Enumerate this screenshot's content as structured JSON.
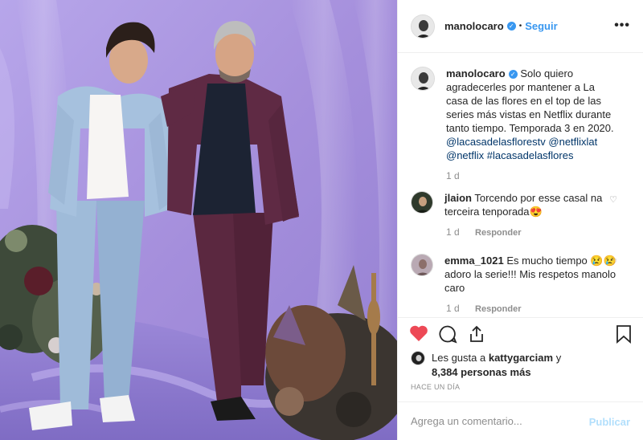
{
  "post": {
    "author": "manolocaro",
    "verified_mark": "✓",
    "dot": "•",
    "follow_label": "Seguir",
    "more_label": "•••"
  },
  "caption": {
    "user": "manolocaro",
    "text": "Solo quiero agradecerles por mantener a La casa de las flores en el top de las series más vistas en Netflix durante tanto tiempo. Temporada 3 en 2020.",
    "tags": [
      "@lacasadelasflorestv",
      "@netflixlat",
      "@netflix",
      "#lacasadelasflores"
    ],
    "age": "1 d"
  },
  "comments": [
    {
      "user": "jlaion",
      "text": "Torcendo por esse casal na terceira tenporada😍",
      "age": "1 d",
      "reply_label": "Responder"
    },
    {
      "user": "emma_1021",
      "text": "Es mucho tiempo 😢😢 adoro la serie!!! Mis respetos manolo caro",
      "age": "1 d",
      "reply_label": "Responder"
    }
  ],
  "icons": {
    "like": "heart-icon",
    "comment": "comment-icon",
    "share": "share-icon",
    "save": "bookmark-icon",
    "comment_like": "heart-outline-icon"
  },
  "likes": {
    "prefix": "Les gusta a",
    "user": "kattygarciam",
    "conj": "y",
    "count": "8,384 personas más"
  },
  "timestamp": "HACE UN DÍA",
  "add_comment": {
    "placeholder": "Agrega un comentario...",
    "publish_label": "Publicar"
  },
  "colors": {
    "accent": "#3897f0",
    "like_red": "#ed4956",
    "muted": "#8e8e8e",
    "publish_disabled": "#b2dffc",
    "backdrop": "#a996dd"
  }
}
